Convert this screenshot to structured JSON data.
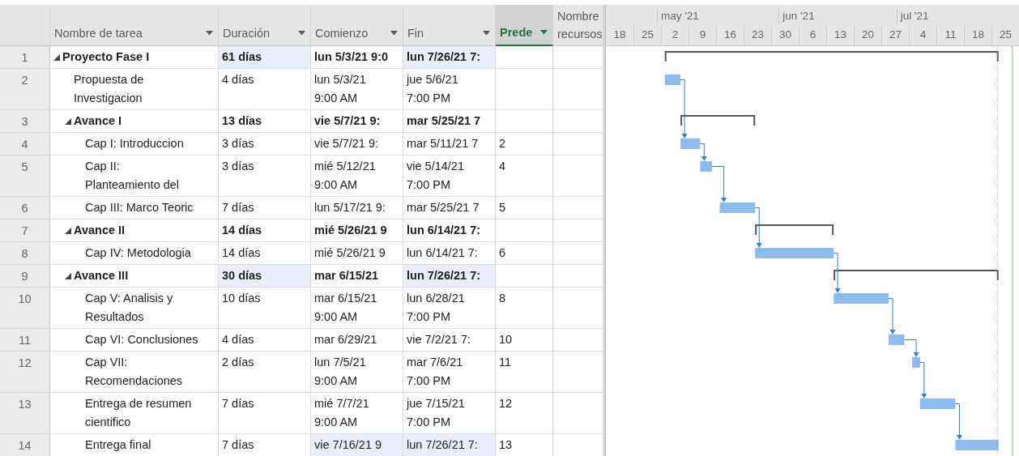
{
  "table": {
    "columns": [
      {
        "label": "Nombre de tarea",
        "filter": true,
        "selected": false
      },
      {
        "label": "Duración",
        "filter": true,
        "selected": false
      },
      {
        "label": "Comienzo",
        "filter": true,
        "selected": false
      },
      {
        "label": "Fin",
        "filter": true,
        "selected": false
      },
      {
        "label": "Prede",
        "filter": true,
        "selected": true
      },
      {
        "label": "Nombre\nrecursos",
        "filter": false,
        "selected": false
      }
    ],
    "rows": [
      {
        "id": "1",
        "name": "Proyecto Fase I",
        "kind": "summary",
        "expanded": true,
        "duration": {
          "text": "61 días",
          "highlighted": true
        },
        "start": {
          "text": "lun 5/3/21 9:0",
          "highlighted": false
        },
        "finish": {
          "text": "lun 7/26/21 7:",
          "highlighted": true
        },
        "predecessors": {
          "highlighted": false
        },
        "children": [
          {
            "id": "2",
            "name": "Propuesta de\nInvestigacion",
            "kind": "task",
            "duration": {
              "text": "4 días",
              "highlighted": false
            },
            "start": {
              "text": "lun 5/3/21\n9:00 AM",
              "highlighted": false
            },
            "finish": {
              "text": "jue 5/6/21\n7:00 PM",
              "highlighted": false
            },
            "predecessors": {
              "highlighted": false
            }
          },
          {
            "id": "3",
            "name": "Avance I",
            "kind": "summary",
            "expanded": true,
            "duration": {
              "text": "13 días",
              "highlighted": false
            },
            "start": {
              "text": "vie 5/7/21 9:",
              "highlighted": false
            },
            "finish": {
              "text": "mar 5/25/21 7",
              "highlighted": false
            },
            "predecessors": {
              "highlighted": false
            },
            "children": [
              {
                "id": "4",
                "name": "Cap I: Introduccion",
                "kind": "task",
                "duration": {
                  "text": "3 días",
                  "highlighted": false
                },
                "start": {
                  "text": "vie 5/7/21 9:",
                  "highlighted": false
                },
                "finish": {
                  "text": "mar 5/11/21 7",
                  "highlighted": false
                },
                "predecessors": {
                  "text": "2",
                  "highlighted": false
                }
              },
              {
                "id": "5",
                "name": "Cap II:\nPlanteamiento del",
                "kind": "task",
                "duration": {
                  "text": "3 días",
                  "highlighted": false
                },
                "start": {
                  "text": "mié 5/12/21\n9:00 AM",
                  "highlighted": false
                },
                "finish": {
                  "text": "vie 5/14/21\n7:00 PM",
                  "highlighted": false
                },
                "predecessors": {
                  "text": "4",
                  "highlighted": false
                }
              },
              {
                "id": "6",
                "name": "Cap III: Marco Teoric",
                "kind": "task",
                "duration": {
                  "text": "7 días",
                  "highlighted": false
                },
                "start": {
                  "text": "lun 5/17/21 9:",
                  "highlighted": false
                },
                "finish": {
                  "text": "mar 5/25/21 7",
                  "highlighted": false
                },
                "predecessors": {
                  "text": "5",
                  "highlighted": false
                }
              }
            ]
          },
          {
            "id": "7",
            "name": "Avance II",
            "kind": "summary",
            "expanded": true,
            "duration": {
              "text": "14 días",
              "highlighted": false
            },
            "start": {
              "text": "mié 5/26/21 9",
              "highlighted": false
            },
            "finish": {
              "text": "lun 6/14/21 7:",
              "highlighted": false
            },
            "predecessors": {
              "highlighted": false
            },
            "children": [
              {
                "id": "8",
                "name": "Cap IV: Metodologia",
                "kind": "task",
                "duration": {
                  "text": "14 días",
                  "highlighted": false
                },
                "start": {
                  "text": "mié 5/26/21 9",
                  "highlighted": false
                },
                "finish": {
                  "text": "lun 6/14/21 7:",
                  "highlighted": false
                },
                "predecessors": {
                  "text": "6",
                  "highlighted": false
                }
              }
            ]
          },
          {
            "id": "9",
            "name": "Avance III",
            "kind": "summary",
            "expanded": true,
            "duration": {
              "text": "30 días",
              "highlighted": true
            },
            "start": {
              "text": "mar 6/15/21",
              "highlighted": false
            },
            "finish": {
              "text": "lun 7/26/21 7:",
              "highlighted": true
            },
            "predecessors": {
              "highlighted": false
            },
            "children": [
              {
                "id": "10",
                "name": "Cap V: Analisis y\nResultados",
                "kind": "task",
                "duration": {
                  "text": "10 días",
                  "highlighted": false
                },
                "start": {
                  "text": "mar 6/15/21\n9:00 AM",
                  "highlighted": false
                },
                "finish": {
                  "text": "lun 6/28/21\n7:00 PM",
                  "highlighted": false
                },
                "predecessors": {
                  "text": "8",
                  "highlighted": false
                }
              },
              {
                "id": "11",
                "name": "Cap VI: Conclusiones",
                "kind": "task",
                "duration": {
                  "text": "4 días",
                  "highlighted": false
                },
                "start": {
                  "text": "mar 6/29/21",
                  "highlighted": false
                },
                "finish": {
                  "text": "vie 7/2/21 7:",
                  "highlighted": false
                },
                "predecessors": {
                  "text": "10",
                  "highlighted": false
                }
              },
              {
                "id": "12",
                "name": "Cap VII:\nRecomendaciones",
                "kind": "task",
                "duration": {
                  "text": "2 días",
                  "highlighted": false
                },
                "start": {
                  "text": "lun 7/5/21\n9:00 AM",
                  "highlighted": false
                },
                "finish": {
                  "text": "mar 7/6/21\n7:00 PM",
                  "highlighted": false
                },
                "predecessors": {
                  "text": "11",
                  "highlighted": false
                }
              },
              {
                "id": "13",
                "name": "Entrega de resumen\ncientifico",
                "kind": "task",
                "duration": {
                  "text": "7 días",
                  "highlighted": false
                },
                "start": {
                  "text": "mié 7/7/21\n9:00 AM",
                  "highlighted": false
                },
                "finish": {
                  "text": "jue 7/15/21\n7:00 PM",
                  "highlighted": false
                },
                "predecessors": {
                  "text": "12",
                  "highlighted": false
                }
              },
              {
                "id": "14",
                "name": "Entrega final",
                "kind": "task",
                "duration": {
                  "text": "7 días",
                  "highlighted": false
                },
                "start": {
                  "text": "vie 7/16/21 9",
                  "highlighted": true
                },
                "finish": {
                  "text": "lun 7/26/21 7:",
                  "highlighted": true
                },
                "predecessors": {
                  "text": "13",
                  "highlighted": false
                }
              }
            ]
          }
        ]
      }
    ]
  },
  "timescale": {
    "months": [
      "may '21",
      "jun '21",
      "jul '21"
    ],
    "weeks": [
      "18",
      "25",
      "2",
      "9",
      "16",
      "23",
      "30",
      "6",
      "13",
      "20",
      "27",
      "4",
      "11",
      "18",
      "25"
    ]
  }
}
